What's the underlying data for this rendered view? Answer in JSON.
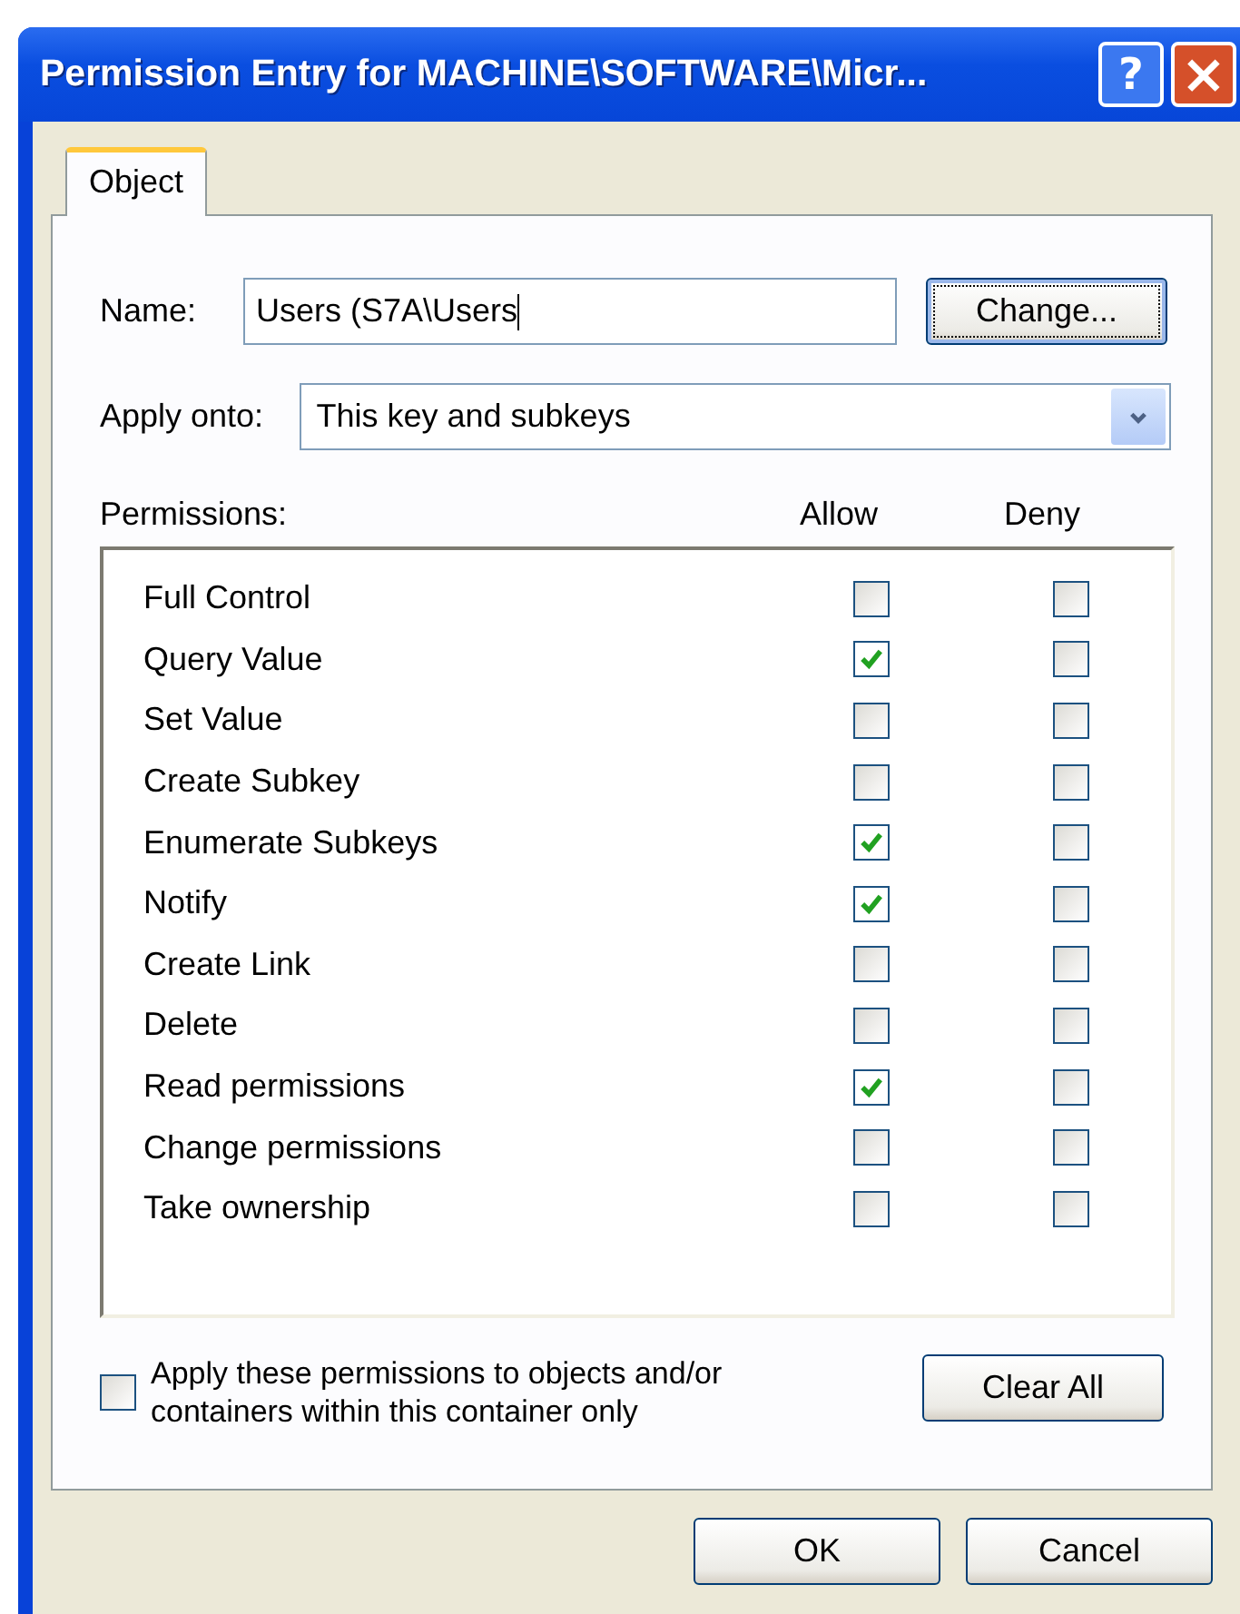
{
  "window": {
    "title": "Permission Entry for MACHINE\\SOFTWARE\\Micr...",
    "help_button": "?",
    "close_button": "×"
  },
  "tabs": [
    {
      "label": "Object",
      "selected": true
    }
  ],
  "name": {
    "label": "Name:",
    "value": "Users (S7A\\Users",
    "focused": true,
    "button": "Change..."
  },
  "apply_onto": {
    "label": "Apply onto:",
    "value": "This key and subkeys"
  },
  "permissions": {
    "label": "Permissions:",
    "columns": [
      "Allow",
      "Deny"
    ],
    "rows": [
      {
        "name": "Full Control",
        "allow": false,
        "deny": false
      },
      {
        "name": "Query Value",
        "allow": true,
        "deny": false
      },
      {
        "name": "Set Value",
        "allow": false,
        "deny": false
      },
      {
        "name": "Create Subkey",
        "allow": false,
        "deny": false
      },
      {
        "name": "Enumerate Subkeys",
        "allow": true,
        "deny": false
      },
      {
        "name": "Notify",
        "allow": true,
        "deny": false
      },
      {
        "name": "Create Link",
        "allow": false,
        "deny": false
      },
      {
        "name": "Delete",
        "allow": false,
        "deny": false
      },
      {
        "name": "Read permissions",
        "allow": true,
        "deny": false
      },
      {
        "name": "Change permissions",
        "allow": false,
        "deny": false
      },
      {
        "name": "Take ownership",
        "allow": false,
        "deny": false
      }
    ]
  },
  "apply_within": {
    "label": "Apply these permissions to objects and/or containers within this container only",
    "checked": false
  },
  "clear_button": "Clear All",
  "buttons": [
    "OK",
    "Cancel"
  ]
}
